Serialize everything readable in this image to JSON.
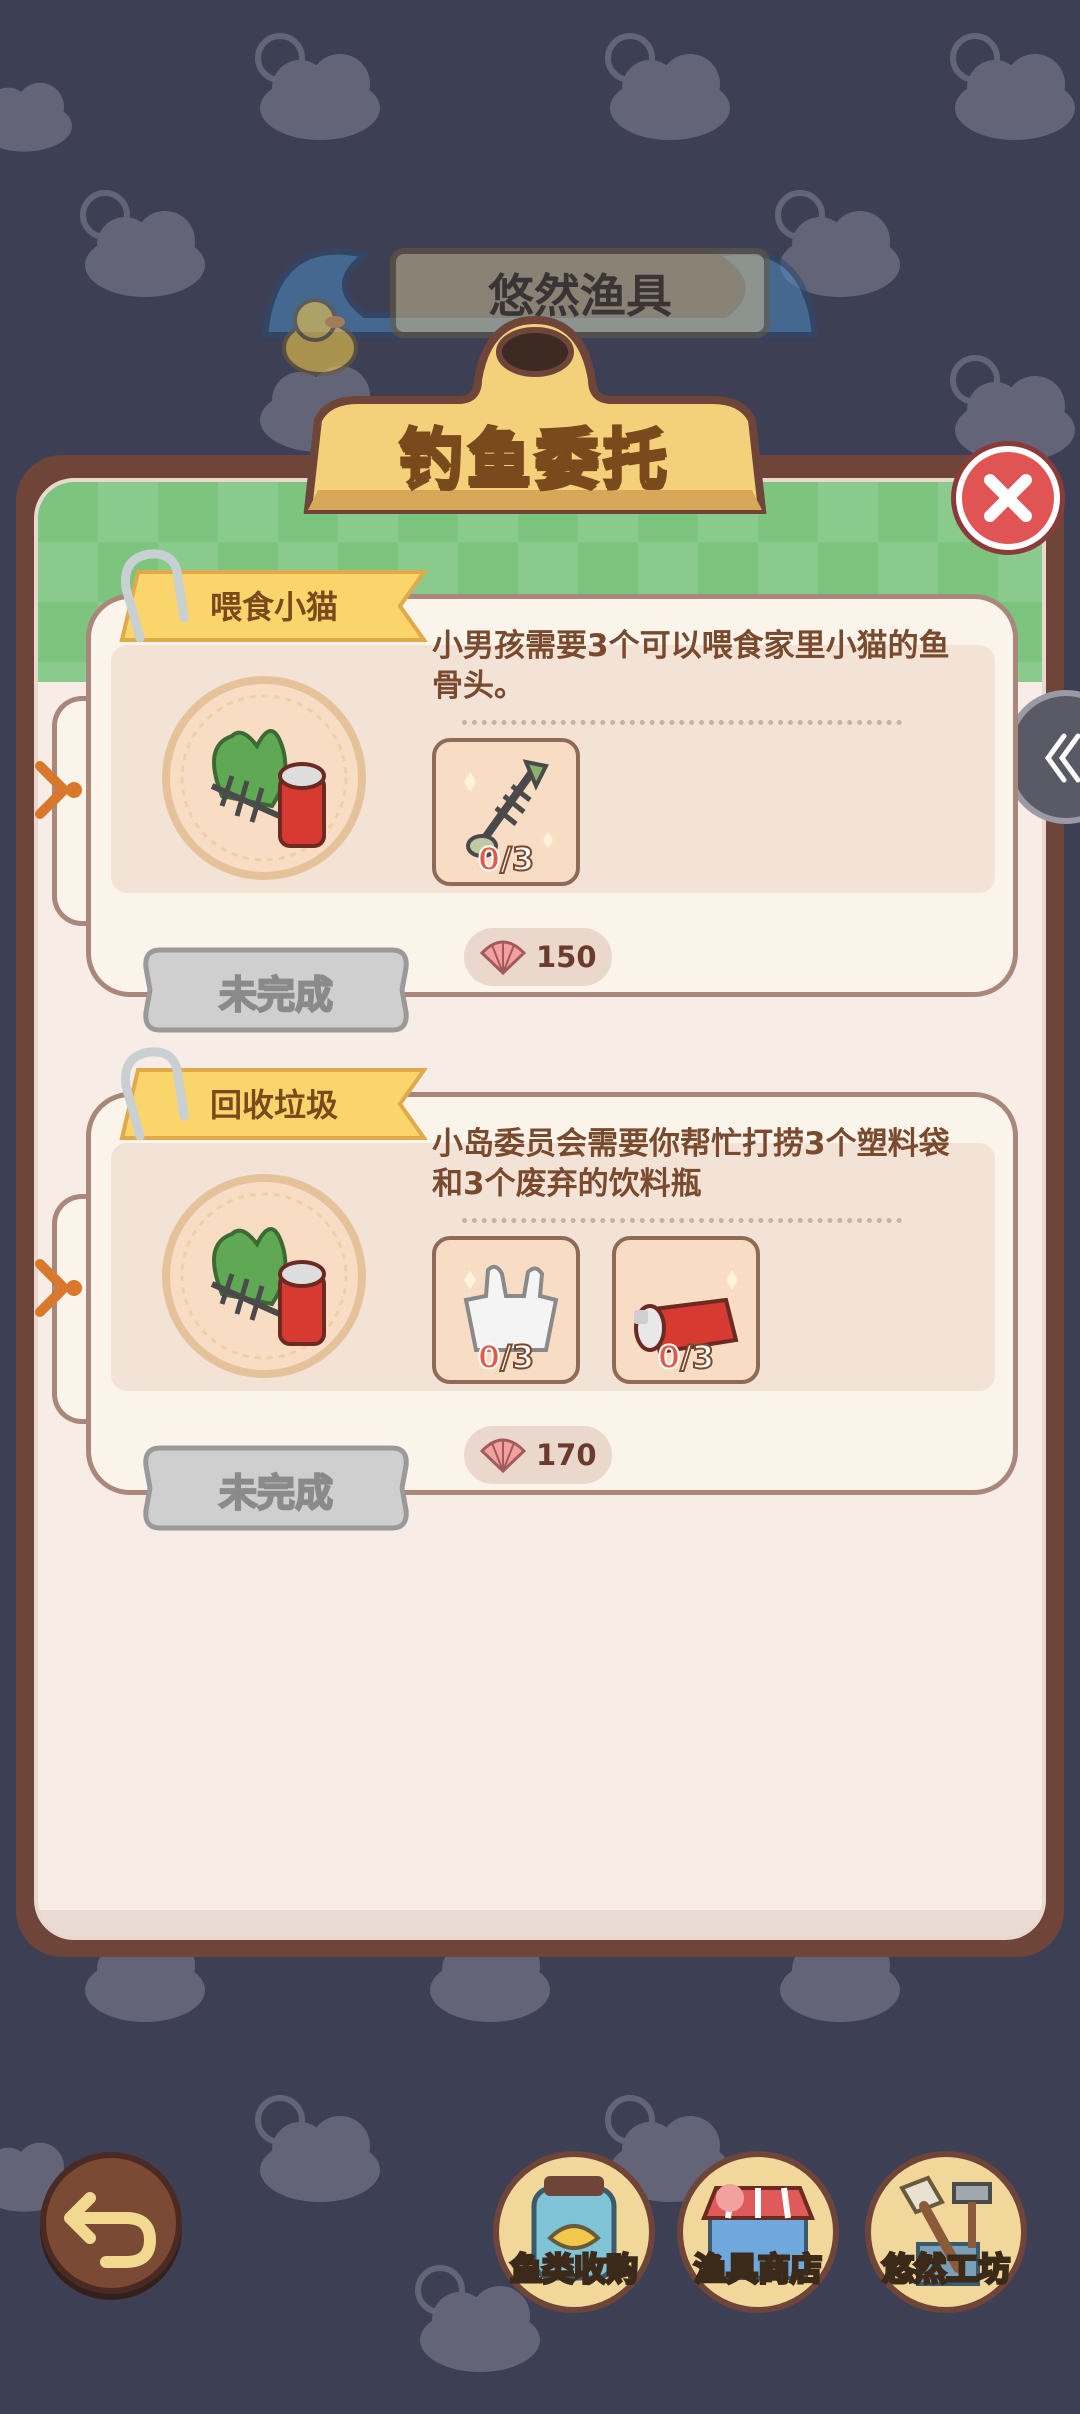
{
  "background": {
    "banner_title": "悠然渔具"
  },
  "panel": {
    "title": "钓鱼委托"
  },
  "quests": [
    {
      "name": "喂食小猫",
      "description": "小男孩需要3个可以喂食家里小猫的鱼骨头。",
      "items": [
        {
          "icon": "fishbone-icon",
          "have": "0",
          "need": "/3"
        }
      ],
      "reward": "150",
      "status": "未完成"
    },
    {
      "name": "回收垃圾",
      "description": "小岛委员会需要你帮忙打捞3个塑料袋和3个废弃的饮料瓶",
      "items": [
        {
          "icon": "plastic-bag-icon",
          "have": "0",
          "need": "/3"
        },
        {
          "icon": "drink-can-icon",
          "have": "0",
          "need": "/3"
        }
      ],
      "reward": "170",
      "status": "未完成"
    }
  ],
  "nav": {
    "fish_buy": "鱼类收购",
    "tackle_shop": "渔具商店",
    "workshop": "悠然工坊"
  },
  "icons": {
    "close": "close-icon",
    "back": "back-arrow-icon",
    "side": "chevron-left-icon",
    "reward": "shell-icon"
  },
  "colors": {
    "background": "#3d3f55",
    "panel_border": "#6e4538",
    "panel_fill": "#f8ece6",
    "header_green": "#7dc47f",
    "close_red": "#e15454",
    "ribbon_yellow": "#f9d56b"
  }
}
